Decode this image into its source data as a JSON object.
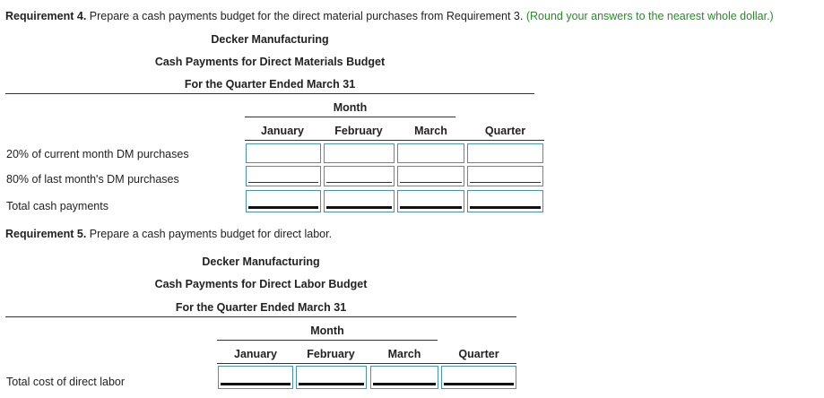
{
  "req4": {
    "title_bold": "Requirement 4.",
    "title_text": " Prepare a cash payments budget for the direct material purchases from Requirement 3.",
    "note": "(Round your answers to the nearest whole dollar.)",
    "company": "Decker Manufacturing",
    "budget_name": "Cash Payments for Direct Materials Budget",
    "period": "For the Quarter Ended March 31",
    "month_header": "Month",
    "columns": [
      "January",
      "February",
      "March",
      "Quarter"
    ],
    "rows": [
      {
        "label": "20% of current month DM purchases"
      },
      {
        "label": "80% of last month's DM purchases"
      },
      {
        "label": "Total cash payments"
      }
    ]
  },
  "req5": {
    "title_bold": "Requirement 5.",
    "title_text": " Prepare a cash payments budget for direct labor.",
    "company": "Decker Manufacturing",
    "budget_name": "Cash Payments for Direct Labor Budget",
    "period": "For the Quarter Ended March 31",
    "month_header": "Month",
    "columns": [
      "January",
      "February",
      "March",
      "Quarter"
    ],
    "rows": [
      {
        "label": "Total cost of direct labor"
      }
    ]
  },
  "colors": {
    "note_green": "#2a8a2a",
    "input_border": "#4a93a8"
  }
}
